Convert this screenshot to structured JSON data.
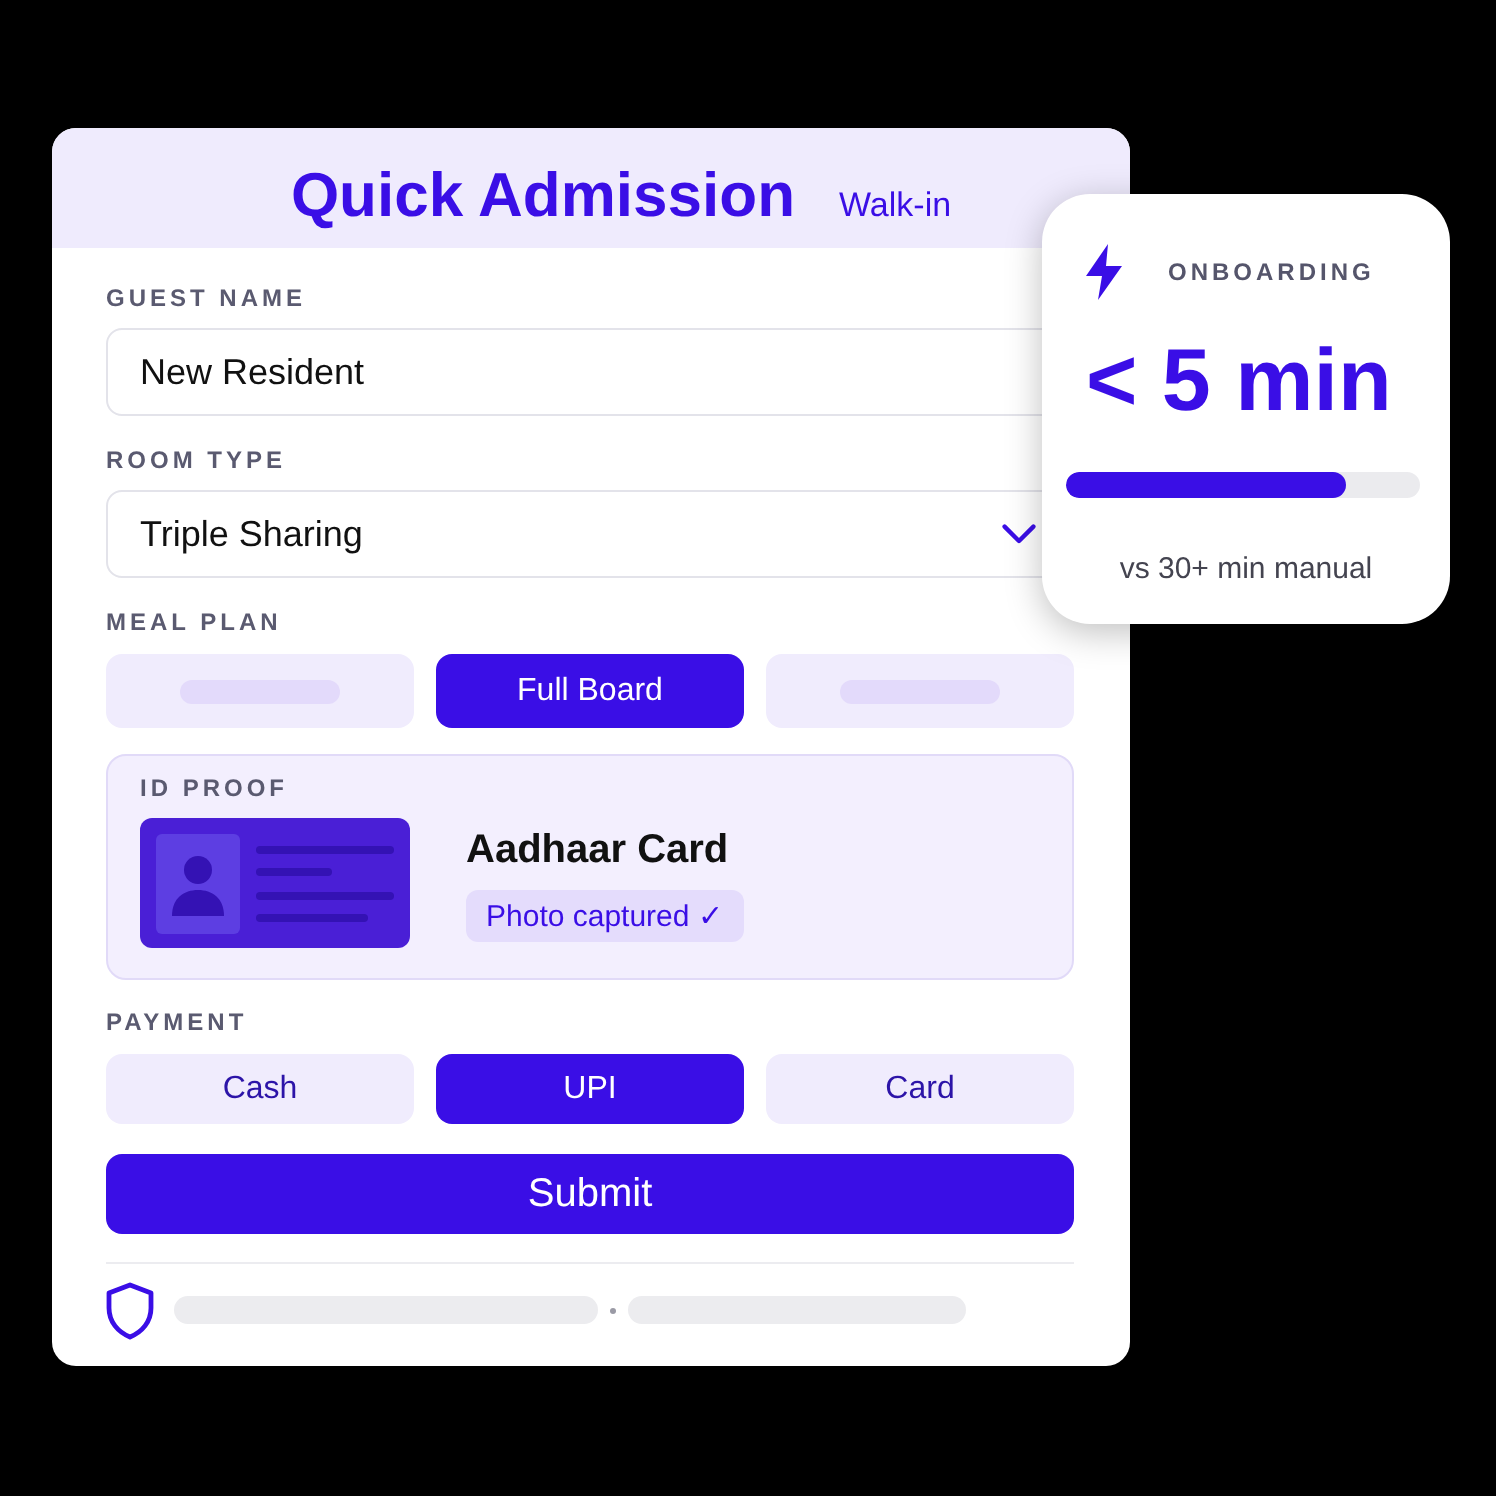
{
  "form": {
    "title": "Quick Admission",
    "badge": "Walk-in"
  },
  "guest_name": {
    "label": "GUEST NAME",
    "value": "New Resident"
  },
  "room_type": {
    "label": "ROOM TYPE",
    "value": "Triple Sharing"
  },
  "meal_plan": {
    "label": "MEAL PLAN",
    "options": [
      {
        "kind": "placeholder",
        "selected": false
      },
      {
        "kind": "text",
        "label": "Full Board",
        "selected": true
      },
      {
        "kind": "placeholder",
        "selected": false
      }
    ]
  },
  "id_proof": {
    "label": "ID PROOF",
    "document": "Aadhaar Card",
    "status": "Photo captured ✓"
  },
  "payment": {
    "label": "PAYMENT",
    "options": [
      {
        "label": "Cash",
        "selected": false
      },
      {
        "label": "UPI",
        "selected": true
      },
      {
        "label": "Card",
        "selected": false
      }
    ]
  },
  "submit": "Submit",
  "onboarding": {
    "label": "ONBOARDING",
    "value": "< 5 min",
    "level": 0.79,
    "comparison": "vs 30+ min manual"
  }
}
